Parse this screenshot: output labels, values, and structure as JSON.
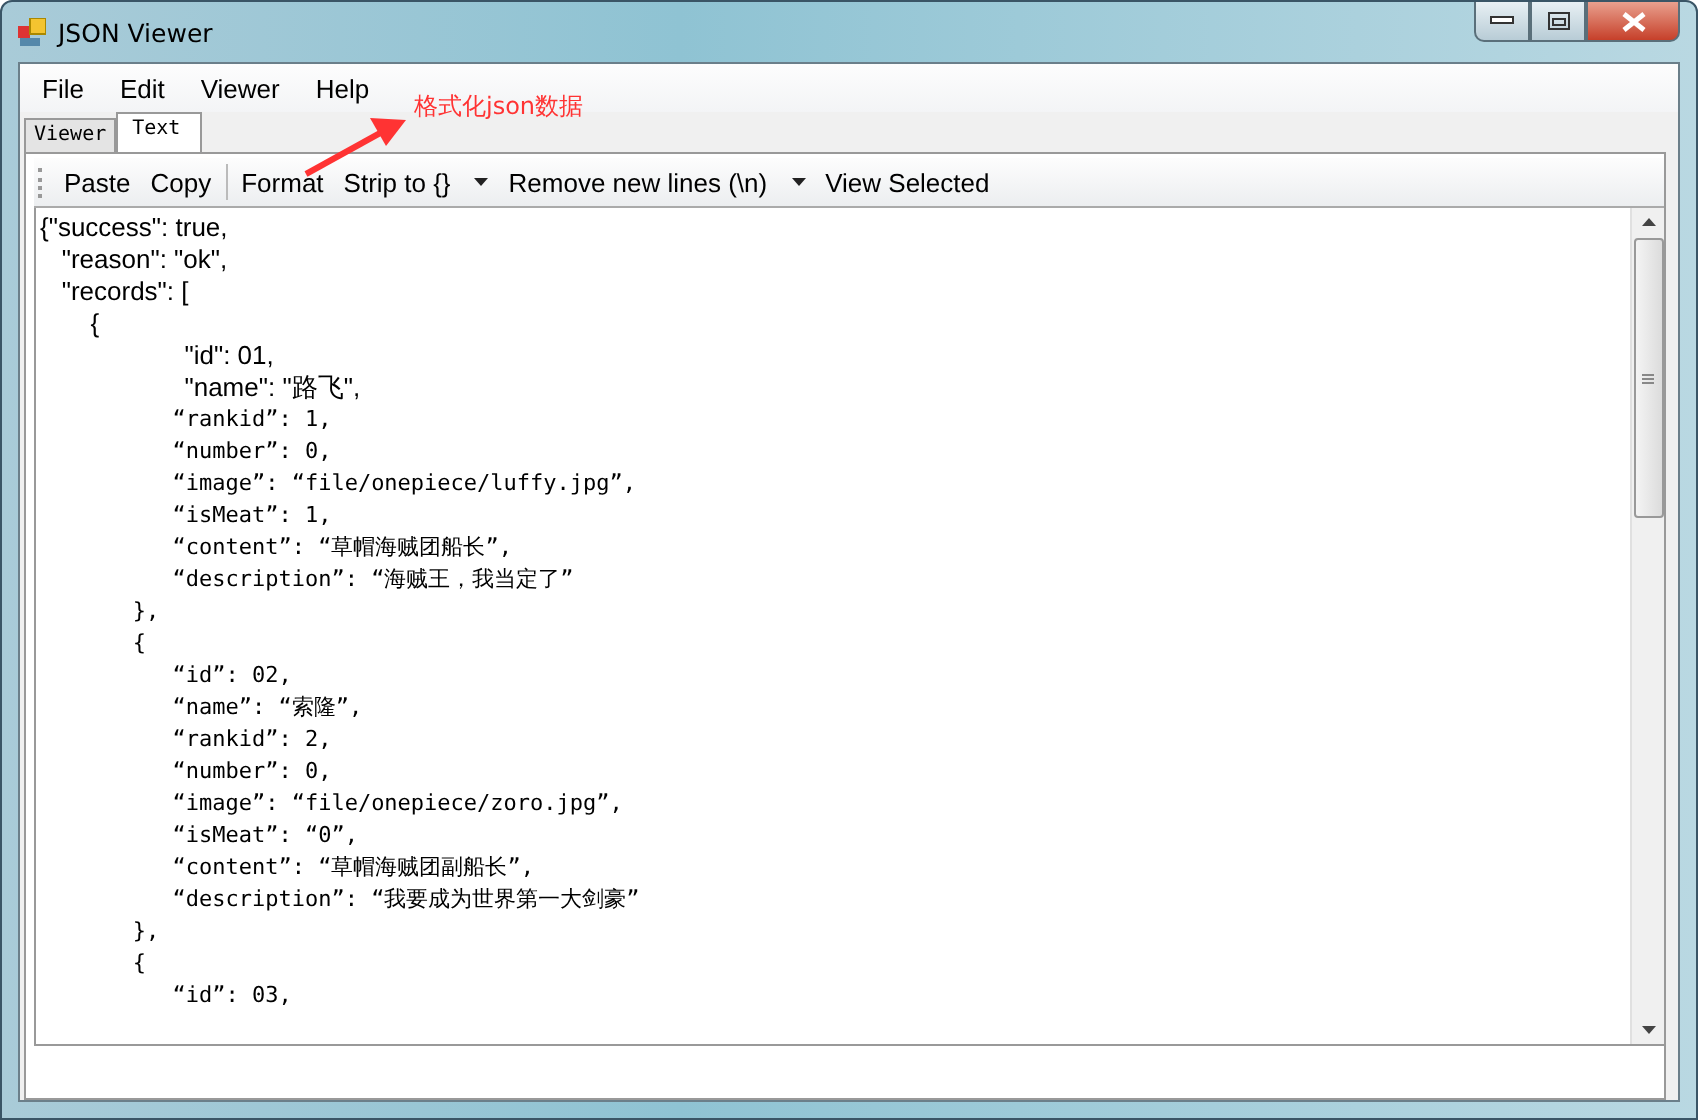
{
  "window": {
    "title": "JSON Viewer"
  },
  "menu": [
    "File",
    "Edit",
    "Viewer",
    "Help"
  ],
  "tabs": [
    {
      "label": "Viewer",
      "selected": false
    },
    {
      "label": "Text",
      "selected": true
    }
  ],
  "toolbar": [
    {
      "kind": "button",
      "label": "Paste"
    },
    {
      "kind": "button",
      "label": "Copy"
    },
    {
      "kind": "separator"
    },
    {
      "kind": "button",
      "label": "Format"
    },
    {
      "kind": "split",
      "label": "Strip to {}"
    },
    {
      "kind": "split",
      "label": "Remove new lines (\\n)"
    },
    {
      "kind": "button",
      "label": "View Selected"
    }
  ],
  "editor": {
    "lines": [
      {
        "kind": "sans",
        "text": "{\"success\": true,"
      },
      {
        "kind": "sans",
        "text": "   \"reason\": \"ok\","
      },
      {
        "kind": "sans",
        "text": "   \"records\": ["
      },
      {
        "kind": "sans",
        "text": "       {"
      },
      {
        "kind": "sans",
        "text": "                    \"id\": 01,"
      },
      {
        "kind": "sans",
        "text": "                    \"name\": \"路飞\","
      },
      {
        "kind": "mono",
        "text": "          “rankid”: 1,"
      },
      {
        "kind": "mono",
        "text": "          “number”: 0,"
      },
      {
        "kind": "mono",
        "text": "          “image”: “file/onepiece/luffy.jpg”,"
      },
      {
        "kind": "mono",
        "text": "          “isMeat”: 1,"
      },
      {
        "kind": "mono",
        "text": "          “content”: “草帽海贼团船长”,"
      },
      {
        "kind": "mono",
        "text": "          “description”: “海贼王，我当定了”"
      },
      {
        "kind": "mono",
        "text": "       },"
      },
      {
        "kind": "mono",
        "text": "       {"
      },
      {
        "kind": "mono",
        "text": "          “id”: 02,"
      },
      {
        "kind": "mono",
        "text": "          “name”: “索隆”,"
      },
      {
        "kind": "mono",
        "text": "          “rankid”: 2,"
      },
      {
        "kind": "mono",
        "text": "          “number”: 0,"
      },
      {
        "kind": "mono",
        "text": "          “image”: “file/onepiece/zoro.jpg”,"
      },
      {
        "kind": "mono",
        "text": "          “isMeat”: “0”,"
      },
      {
        "kind": "mono",
        "text": "          “content”: “草帽海贼团副船长”,"
      },
      {
        "kind": "mono",
        "text": "          “description”: “我要成为世界第一大剑豪”"
      },
      {
        "kind": "mono",
        "text": "       },"
      },
      {
        "kind": "mono",
        "text": "       {"
      },
      {
        "kind": "mono",
        "text": "          “id”: 03,"
      }
    ]
  },
  "annotation": {
    "text": "格式化json数据"
  }
}
